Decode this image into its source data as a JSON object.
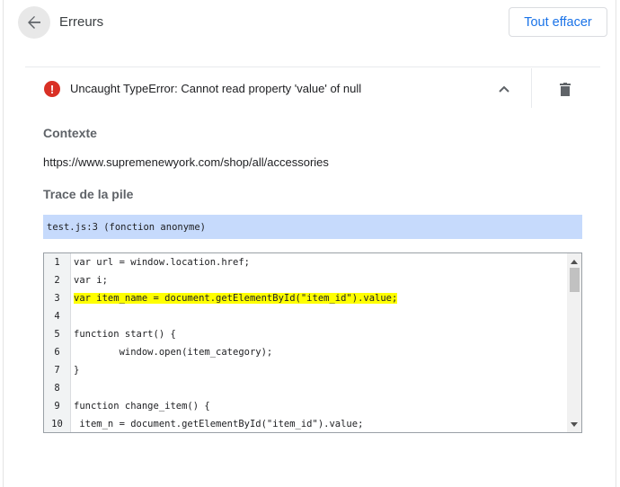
{
  "header": {
    "back_icon": "arrow-back-icon",
    "title": "Erreurs",
    "clear_all_label": "Tout effacer"
  },
  "error": {
    "icon": "error-icon",
    "icon_glyph": "!",
    "message": "Uncaught TypeError: Cannot read property 'value' of null",
    "collapse_icon": "chevron-up-icon",
    "delete_icon": "trash-icon"
  },
  "context": {
    "heading": "Contexte",
    "url": "https://www.supremenewyork.com/shop/all/accessories"
  },
  "stack_trace": {
    "heading": "Trace de la pile",
    "frames": [
      "test.js:3 (fonction anonyme)"
    ]
  },
  "code": {
    "lines": [
      {
        "num": "1",
        "text": "var url = window.location.href;",
        "highlight": false
      },
      {
        "num": "2",
        "text": "var i;",
        "highlight": false
      },
      {
        "num": "3",
        "text": "var item_name = document.getElementById(\"item_id\").value;",
        "highlight": true
      },
      {
        "num": "4",
        "text": "",
        "highlight": false
      },
      {
        "num": "5",
        "text": "function start() {",
        "highlight": false
      },
      {
        "num": "6",
        "text": "        window.open(item_category);",
        "highlight": false
      },
      {
        "num": "7",
        "text": "}",
        "highlight": false
      },
      {
        "num": "8",
        "text": "",
        "highlight": false
      },
      {
        "num": "9",
        "text": "function change_item() {",
        "highlight": false
      },
      {
        "num": "10",
        "text": " item_n = document.getElementById(\"item_id\").value;",
        "highlight": false
      }
    ],
    "highlight_color": "#ffff00"
  },
  "colors": {
    "accent": "#1a73e8",
    "error": "#d93025",
    "stack_frame_bg": "#c6dafc"
  }
}
